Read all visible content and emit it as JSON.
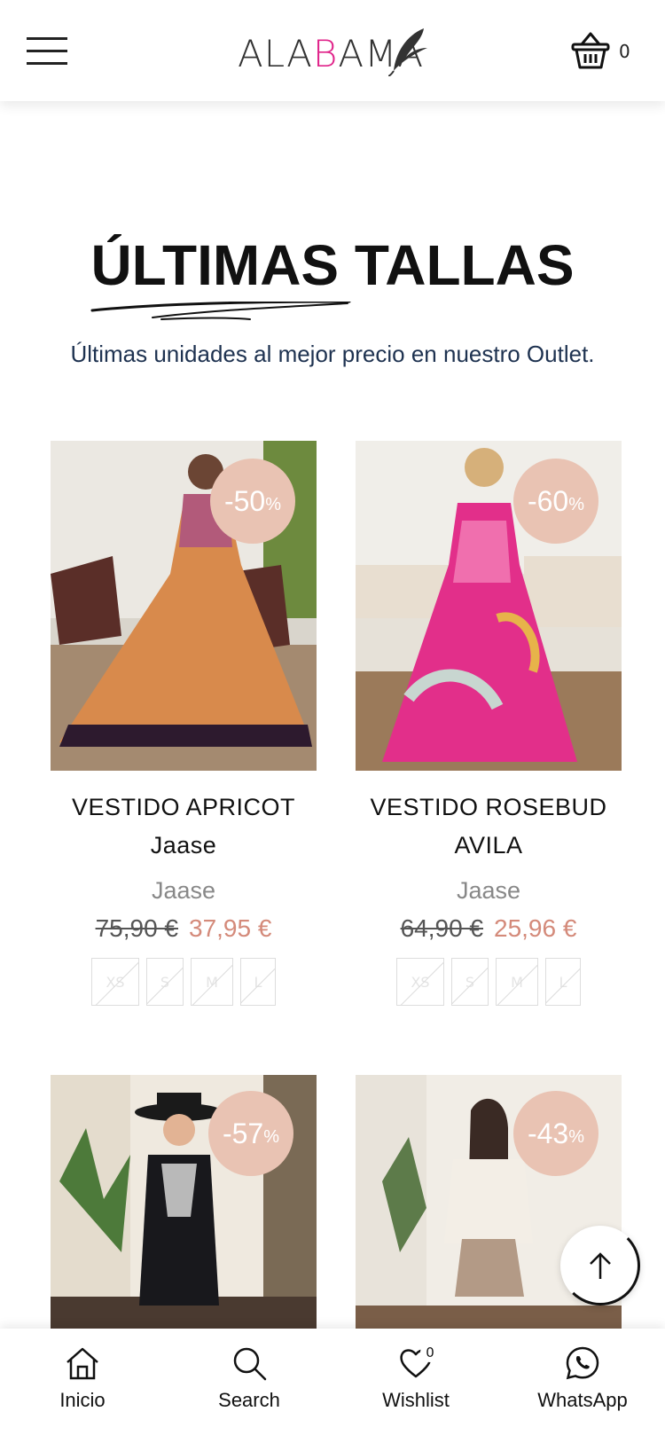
{
  "header": {
    "logo_text": "ALABAMA",
    "cart_count": "0"
  },
  "section": {
    "title": "ÚLTIMAS TALLAS",
    "subtitle": "Últimas unidades al mejor precio en nuestro Outlet."
  },
  "products": [
    {
      "name_line1": "VESTIDO APRICOT",
      "name_line2": "Jaase",
      "brand": "Jaase",
      "old_price": "75,90 €",
      "new_price": "37,95 €",
      "discount": "-50",
      "discount_suffix": "%",
      "sizes": [
        "XS",
        "S",
        "M",
        "L"
      ]
    },
    {
      "name_line1": "VESTIDO ROSEBUD",
      "name_line2": "AVILA",
      "brand": "Jaase",
      "old_price": "64,90 €",
      "new_price": "25,96 €",
      "discount": "-60",
      "discount_suffix": "%",
      "sizes": [
        "XS",
        "S",
        "M",
        "L"
      ]
    },
    {
      "discount": "-57",
      "discount_suffix": "%"
    },
    {
      "discount": "-43",
      "discount_suffix": "%"
    }
  ],
  "bottom_nav": {
    "items": [
      {
        "label": "Inicio",
        "icon": "home-icon"
      },
      {
        "label": "Search",
        "icon": "search-icon"
      },
      {
        "label": "Wishlist",
        "icon": "heart-icon"
      },
      {
        "label": "WhatsApp",
        "icon": "whatsapp-icon"
      }
    ],
    "wishlist_count": "0"
  },
  "colors": {
    "badge": "#e9c3b3",
    "sale_price": "#d48a7a",
    "logo_accent": "#e0248a",
    "subtitle": "#1e3250"
  }
}
